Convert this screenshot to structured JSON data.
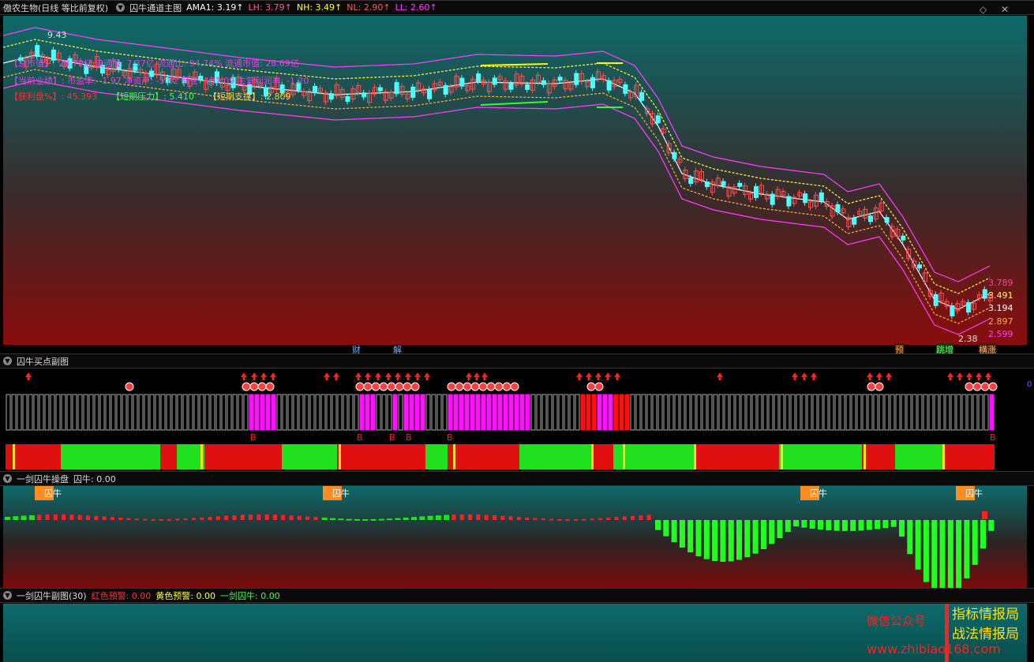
{
  "topbar": {
    "stock": "傲农生物(日线 等比前复权)",
    "indicator": "囚牛通道主图",
    "ama1": "AMA1: 3.19↑",
    "lh": "LH: 3.79↑",
    "nh": "NH: 3.49↑",
    "nl": "NL: 2.90↑",
    "ll": "LL: 2.60↑",
    "colors": {
      "ama1": "#ffffff",
      "lh": "#ff5a8a",
      "nh": "#ffff40",
      "nl": "#ff6040",
      "ll": "#ff40ff"
    }
  },
  "main": {
    "price_high_label": "9.43",
    "price_low_label": "2.38",
    "right_labels": [
      "3.789",
      "3.491",
      "3.194",
      "2.897",
      "2.599"
    ],
    "info1": "【总市值】: 28.70亿 流通股: 7.37亿 流通比: 94.74% 流通市值: 28.69亿",
    "info2": "【当前业绩】: 市盈率: -1.97 净资产: -5.82 商誉: 181.09 主营利润率: -1.20",
    "info3a": "【获利盘%】: ",
    "info3b": "45.393",
    "info3c": "【短期压力】: ",
    "info3d": "5.410",
    "info3e": "【短期支撑】: ",
    "info3f": "2.809",
    "bottom_tags": [
      {
        "text": "财",
        "color": "#6ab4ff"
      },
      {
        "text": "解",
        "color": "#6ab4ff"
      },
      {
        "text": "预",
        "color": "#ff9b3a"
      },
      {
        "text": "跳增",
        "color": "#60ff60"
      },
      {
        "text": "横涨",
        "color": "#ffb060"
      }
    ]
  },
  "sub1": {
    "title": "囚牛买点副图",
    "b_label": "B",
    "right_value": "0"
  },
  "sub2": {
    "title": "一剑囚牛操盘",
    "value": "囚牛: 0.00",
    "tag": "囚牛"
  },
  "sub3": {
    "title": "一剑囚牛副图(30)",
    "red": "红色预警: 0.00",
    "yellow": "黄色预警: 0.00",
    "green": "一剑囚牛: 0.00"
  },
  "watermark": {
    "line1": "微信公众号",
    "line2": "指标情报局",
    "line3": "战法情报局",
    "line4": "www.zhibiao168.com"
  },
  "toolbar_icons": [
    "diamond-icon",
    "settings-icon"
  ]
}
